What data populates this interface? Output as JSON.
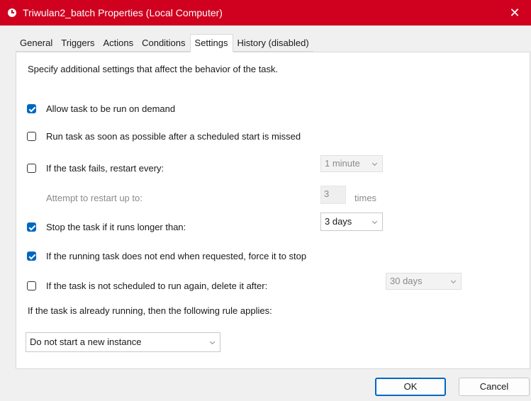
{
  "window": {
    "title": "Triwulan2_batch Properties (Local Computer)",
    "close_glyph": "✕"
  },
  "tabs": [
    {
      "label": "General"
    },
    {
      "label": "Triggers"
    },
    {
      "label": "Actions"
    },
    {
      "label": "Conditions"
    },
    {
      "label": "Settings",
      "active": true
    },
    {
      "label": "History (disabled)"
    }
  ],
  "settings": {
    "description": "Specify additional settings that affect the behavior of the task.",
    "allow_on_demand": {
      "label": "Allow task to be run on demand",
      "checked": true
    },
    "run_missed": {
      "label": "Run task as soon as possible after a scheduled start is missed",
      "checked": false
    },
    "restart_on_fail": {
      "label": "If the task fails, restart every:",
      "checked": false,
      "value": "1 minute"
    },
    "restart_attempts": {
      "label": "Attempt to restart up to:",
      "value": "3",
      "suffix": "times"
    },
    "stop_if_longer": {
      "label": "Stop the task if it runs longer than:",
      "checked": true,
      "value": "3 days"
    },
    "force_stop": {
      "label": "If the running task does not end when requested, force it to stop",
      "checked": true
    },
    "delete_after": {
      "label": "If the task is not scheduled to run again, delete it after:",
      "checked": false,
      "value": "30 days"
    },
    "running_rule": {
      "label": "If the task is already running, then the following rule applies:",
      "value": "Do not start a new instance"
    }
  },
  "buttons": {
    "ok": "OK",
    "cancel": "Cancel"
  },
  "colors": {
    "titlebar": "#d0001f",
    "accent": "#0067c0"
  }
}
